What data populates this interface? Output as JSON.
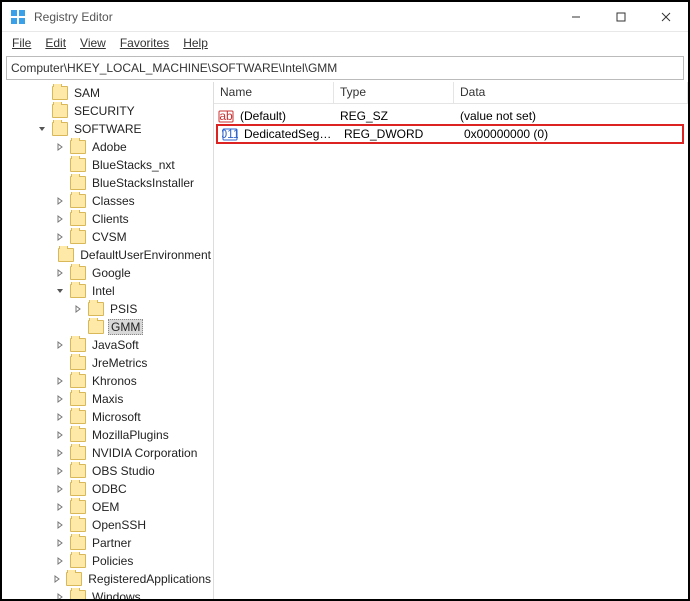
{
  "window": {
    "title": "Registry Editor"
  },
  "menu": {
    "file": "File",
    "edit": "Edit",
    "view": "View",
    "favorites": "Favorites",
    "help": "Help"
  },
  "addressbar": {
    "path": "Computer\\HKEY_LOCAL_MACHINE\\SOFTWARE\\Intel\\GMM"
  },
  "list": {
    "headers": {
      "name": "Name",
      "type": "Type",
      "data": "Data"
    },
    "rows": [
      {
        "icon": "sz",
        "name": "(Default)",
        "type": "REG_SZ",
        "data": "(value not set)",
        "highlight": false
      },
      {
        "icon": "dw",
        "name": "DedicatedSegm...",
        "type": "REG_DWORD",
        "data": "0x00000000 (0)",
        "highlight": true
      }
    ]
  },
  "tree": {
    "items": [
      {
        "depth": 2,
        "exp": "",
        "label": "SAM"
      },
      {
        "depth": 2,
        "exp": "",
        "label": "SECURITY"
      },
      {
        "depth": 2,
        "exp": "v",
        "label": "SOFTWARE"
      },
      {
        "depth": 3,
        "exp": ">",
        "label": "Adobe"
      },
      {
        "depth": 3,
        "exp": "",
        "label": "BlueStacks_nxt"
      },
      {
        "depth": 3,
        "exp": "",
        "label": "BlueStacksInstaller"
      },
      {
        "depth": 3,
        "exp": ">",
        "label": "Classes"
      },
      {
        "depth": 3,
        "exp": ">",
        "label": "Clients"
      },
      {
        "depth": 3,
        "exp": ">",
        "label": "CVSM"
      },
      {
        "depth": 3,
        "exp": "",
        "label": "DefaultUserEnvironment"
      },
      {
        "depth": 3,
        "exp": ">",
        "label": "Google"
      },
      {
        "depth": 3,
        "exp": "v",
        "label": "Intel"
      },
      {
        "depth": 4,
        "exp": ">",
        "label": "PSIS"
      },
      {
        "depth": 4,
        "exp": "",
        "label": "GMM",
        "selected": true
      },
      {
        "depth": 3,
        "exp": ">",
        "label": "JavaSoft"
      },
      {
        "depth": 3,
        "exp": "",
        "label": "JreMetrics"
      },
      {
        "depth": 3,
        "exp": ">",
        "label": "Khronos"
      },
      {
        "depth": 3,
        "exp": ">",
        "label": "Maxis"
      },
      {
        "depth": 3,
        "exp": ">",
        "label": "Microsoft"
      },
      {
        "depth": 3,
        "exp": ">",
        "label": "MozillaPlugins"
      },
      {
        "depth": 3,
        "exp": ">",
        "label": "NVIDIA Corporation"
      },
      {
        "depth": 3,
        "exp": ">",
        "label": "OBS Studio"
      },
      {
        "depth": 3,
        "exp": ">",
        "label": "ODBC"
      },
      {
        "depth": 3,
        "exp": ">",
        "label": "OEM"
      },
      {
        "depth": 3,
        "exp": ">",
        "label": "OpenSSH"
      },
      {
        "depth": 3,
        "exp": ">",
        "label": "Partner"
      },
      {
        "depth": 3,
        "exp": ">",
        "label": "Policies"
      },
      {
        "depth": 3,
        "exp": ">",
        "label": "RegisteredApplications"
      },
      {
        "depth": 3,
        "exp": ">",
        "label": "Windows"
      }
    ]
  }
}
